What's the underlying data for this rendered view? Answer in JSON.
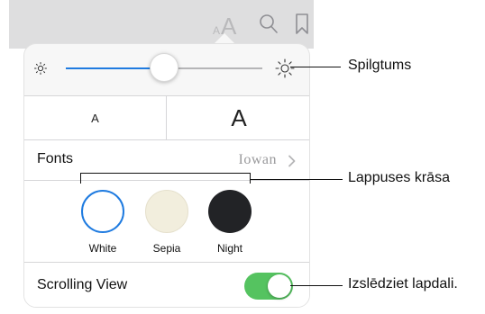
{
  "toolbar": {
    "font_size_small": "A",
    "font_size_large": "A",
    "icons": [
      "font-size-icon",
      "search-icon",
      "bookmark-icon"
    ]
  },
  "brightness": {
    "level": 0.45,
    "min_icon": "sun-small-icon",
    "max_icon": "sun-large-icon"
  },
  "font_size": {
    "smaller_label": "A",
    "larger_label": "A"
  },
  "fonts": {
    "label": "Fonts",
    "value": "Iowan"
  },
  "themes": [
    {
      "label": "White",
      "color": "#ffffff",
      "selected": true
    },
    {
      "label": "Sepia",
      "color": "#f2eedd",
      "selected": false
    },
    {
      "label": "Night",
      "color": "#222326",
      "selected": false
    }
  ],
  "scrolling": {
    "label": "Scrolling View",
    "on": true
  },
  "callouts": {
    "brightness": "Spilgtums",
    "themes": "Lappuses krāsa",
    "scrolling": "Izslēdziet lapdali."
  },
  "colors": {
    "accent": "#1f7be0",
    "toggle_on": "#55c360"
  }
}
